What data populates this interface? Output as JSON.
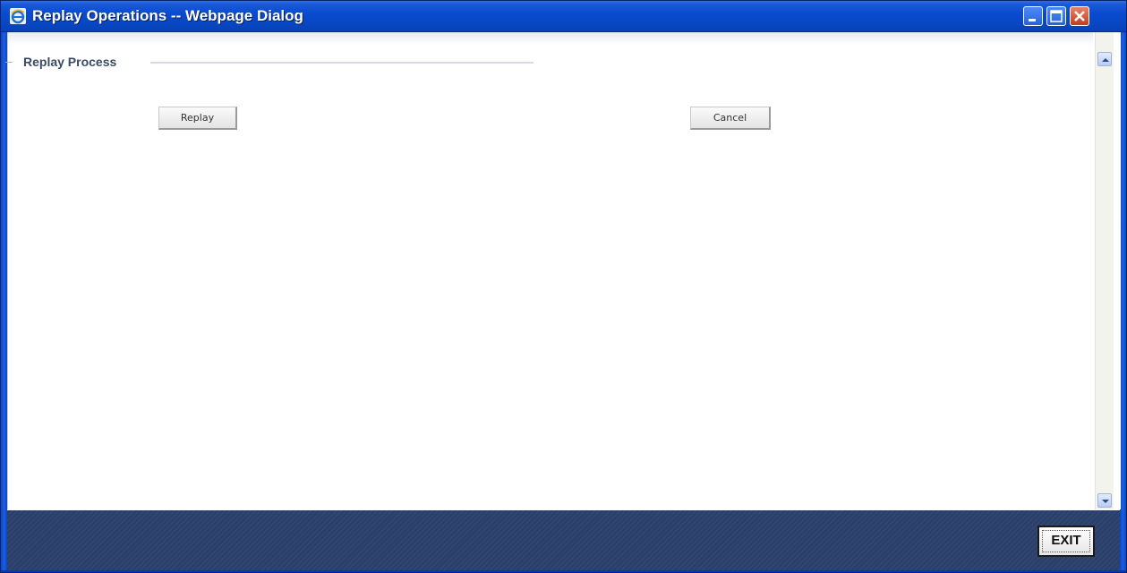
{
  "window": {
    "title": "Replay Operations -- Webpage Dialog"
  },
  "section": {
    "legend": "Replay Process"
  },
  "buttons": {
    "replay": "Replay",
    "cancel": "Cancel",
    "exit": "EXIT"
  },
  "icons": {
    "app": "ie-icon",
    "minimize": "minimize-icon",
    "maximize": "maximize-icon",
    "close": "close-icon",
    "scroll_up": "scroll-up-arrow-icon",
    "scroll_down": "scroll-down-arrow-icon"
  },
  "colors": {
    "titlebar": "#0748c6",
    "footer": "#2a3f6a",
    "close_button": "#c43d1c",
    "legend_text": "#3a4a66"
  }
}
